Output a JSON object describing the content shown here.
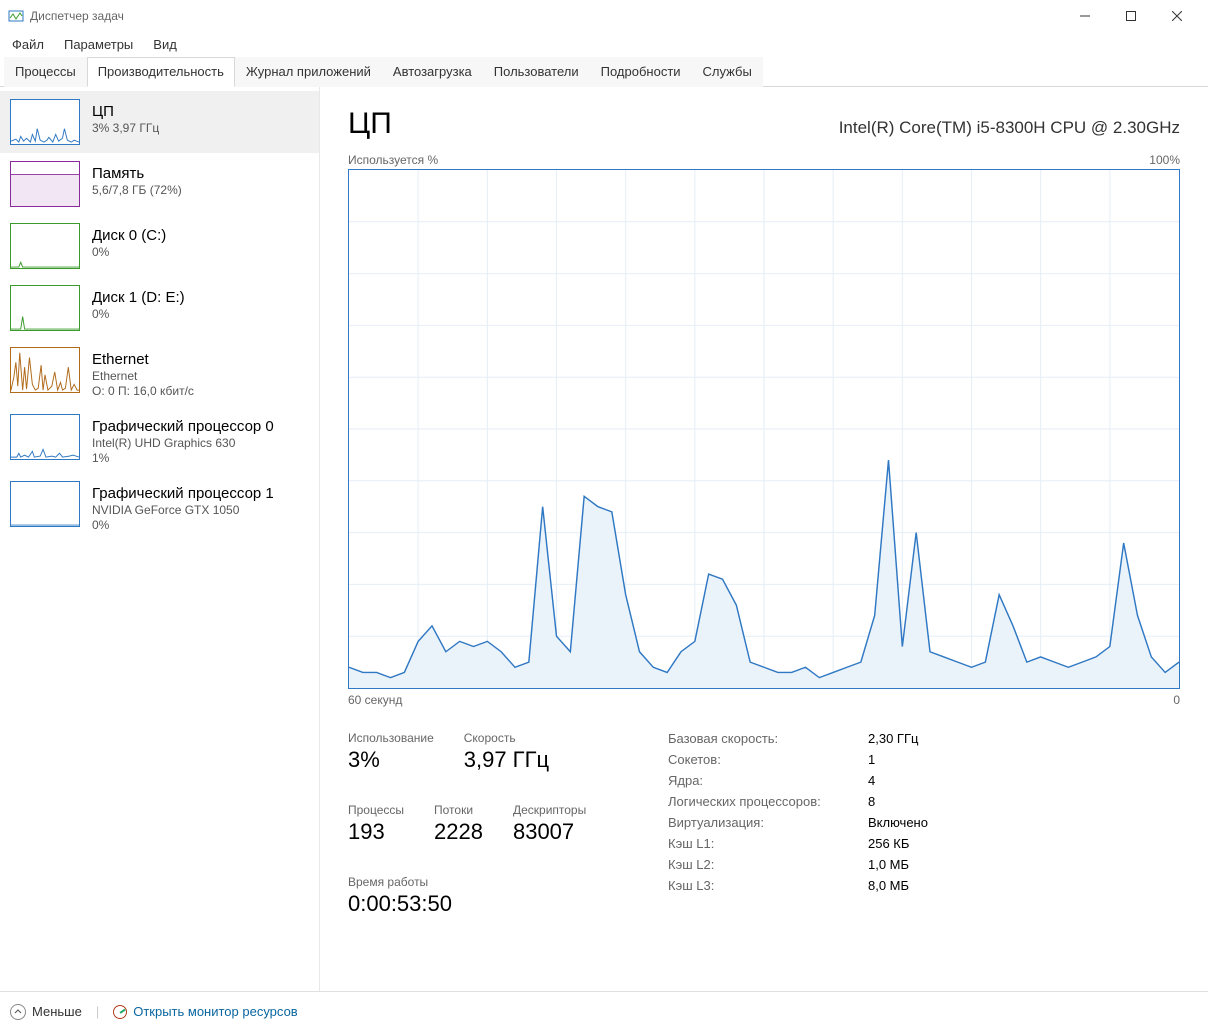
{
  "window": {
    "title": "Диспетчер задач"
  },
  "menu": {
    "file": "Файл",
    "options": "Параметры",
    "view": "Вид"
  },
  "tabs": {
    "processes": "Процессы",
    "performance": "Производительность",
    "apphistory": "Журнал приложений",
    "startup": "Автозагрузка",
    "users": "Пользователи",
    "details": "Подробности",
    "services": "Службы"
  },
  "sidebar": [
    {
      "id": "cpu",
      "color": "#2f78c3",
      "title": "ЦП",
      "sub": "3%  3,97 ГГц"
    },
    {
      "id": "mem",
      "color": "#8a2a9b",
      "title": "Память",
      "sub": "5,6/7,8 ГБ (72%)"
    },
    {
      "id": "disk0",
      "color": "#3a9b2a",
      "title": "Диск 0 (C:)",
      "sub": "0%"
    },
    {
      "id": "disk1",
      "color": "#3a9b2a",
      "title": "Диск 1 (D: E:)",
      "sub": "0%"
    },
    {
      "id": "eth",
      "color": "#b06a1a",
      "title": "Ethernet",
      "sub": "Ethernet",
      "sub2": "О: 0  П: 16,0 кбит/с"
    },
    {
      "id": "gpu0",
      "color": "#2f78c3",
      "title": "Графический процессор 0",
      "sub": "Intel(R) UHD Graphics 630",
      "sub2": "1%"
    },
    {
      "id": "gpu1",
      "color": "#2f78c3",
      "title": "Графический процессор 1",
      "sub": "NVIDIA GeForce GTX 1050",
      "sub2": "0%"
    }
  ],
  "main": {
    "title": "ЦП",
    "model": "Intel(R) Core(TM) i5-8300H CPU @ 2.30GHz",
    "chart_title": "Используется %",
    "chart_max": "100%",
    "x_left": "60 секунд",
    "x_right": "0"
  },
  "stats": {
    "usage_label": "Использование",
    "usage": "3%",
    "speed_label": "Скорость",
    "speed": "3,97 ГГц",
    "procs_label": "Процессы",
    "procs": "193",
    "threads_label": "Потоки",
    "threads": "2228",
    "handles_label": "Дескрипторы",
    "handles": "83007",
    "uptime_label": "Время работы",
    "uptime": "0:00:53:50"
  },
  "spec_labels": {
    "base": "Базовая скорость:",
    "sockets": "Сокетов:",
    "cores": "Ядра:",
    "lprocs": "Логических процессоров:",
    "virt": "Виртуализация:",
    "l1": "Кэш L1:",
    "l2": "Кэш L2:",
    "l3": "Кэш L3:"
  },
  "spec": {
    "base": "2,30 ГГц",
    "sockets": "1",
    "cores": "4",
    "lprocs": "8",
    "virt": "Включено",
    "l1": "256 КБ",
    "l2": "1,0 МБ",
    "l3": "8,0 МБ"
  },
  "footer": {
    "fewer": "Меньше",
    "resmon": "Открыть монитор ресурсов"
  },
  "chart_data": {
    "type": "area",
    "title": "Используется %",
    "xlabel": "секунд",
    "ylabel": "%",
    "xlim": [
      60,
      0
    ],
    "ylim": [
      0,
      100
    ],
    "x": [
      60,
      59,
      58,
      57,
      56,
      55,
      54,
      53,
      52,
      51,
      50,
      49,
      48,
      47,
      46,
      45,
      44,
      43,
      42,
      41,
      40,
      39,
      38,
      37,
      36,
      35,
      34,
      33,
      32,
      31,
      30,
      29,
      28,
      27,
      26,
      25,
      24,
      23,
      22,
      21,
      20,
      19,
      18,
      17,
      16,
      15,
      14,
      13,
      12,
      11,
      10,
      9,
      8,
      7,
      6,
      5,
      4,
      3,
      2,
      1,
      0
    ],
    "values": [
      4,
      3,
      3,
      2,
      3,
      9,
      12,
      7,
      9,
      8,
      9,
      7,
      4,
      5,
      35,
      10,
      7,
      37,
      35,
      34,
      18,
      7,
      4,
      3,
      7,
      9,
      22,
      21,
      16,
      5,
      4,
      3,
      3,
      4,
      2,
      3,
      4,
      5,
      14,
      44,
      8,
      30,
      7,
      6,
      5,
      4,
      5,
      18,
      12,
      5,
      6,
      5,
      4,
      5,
      6,
      8,
      28,
      14,
      6,
      3,
      5
    ]
  }
}
